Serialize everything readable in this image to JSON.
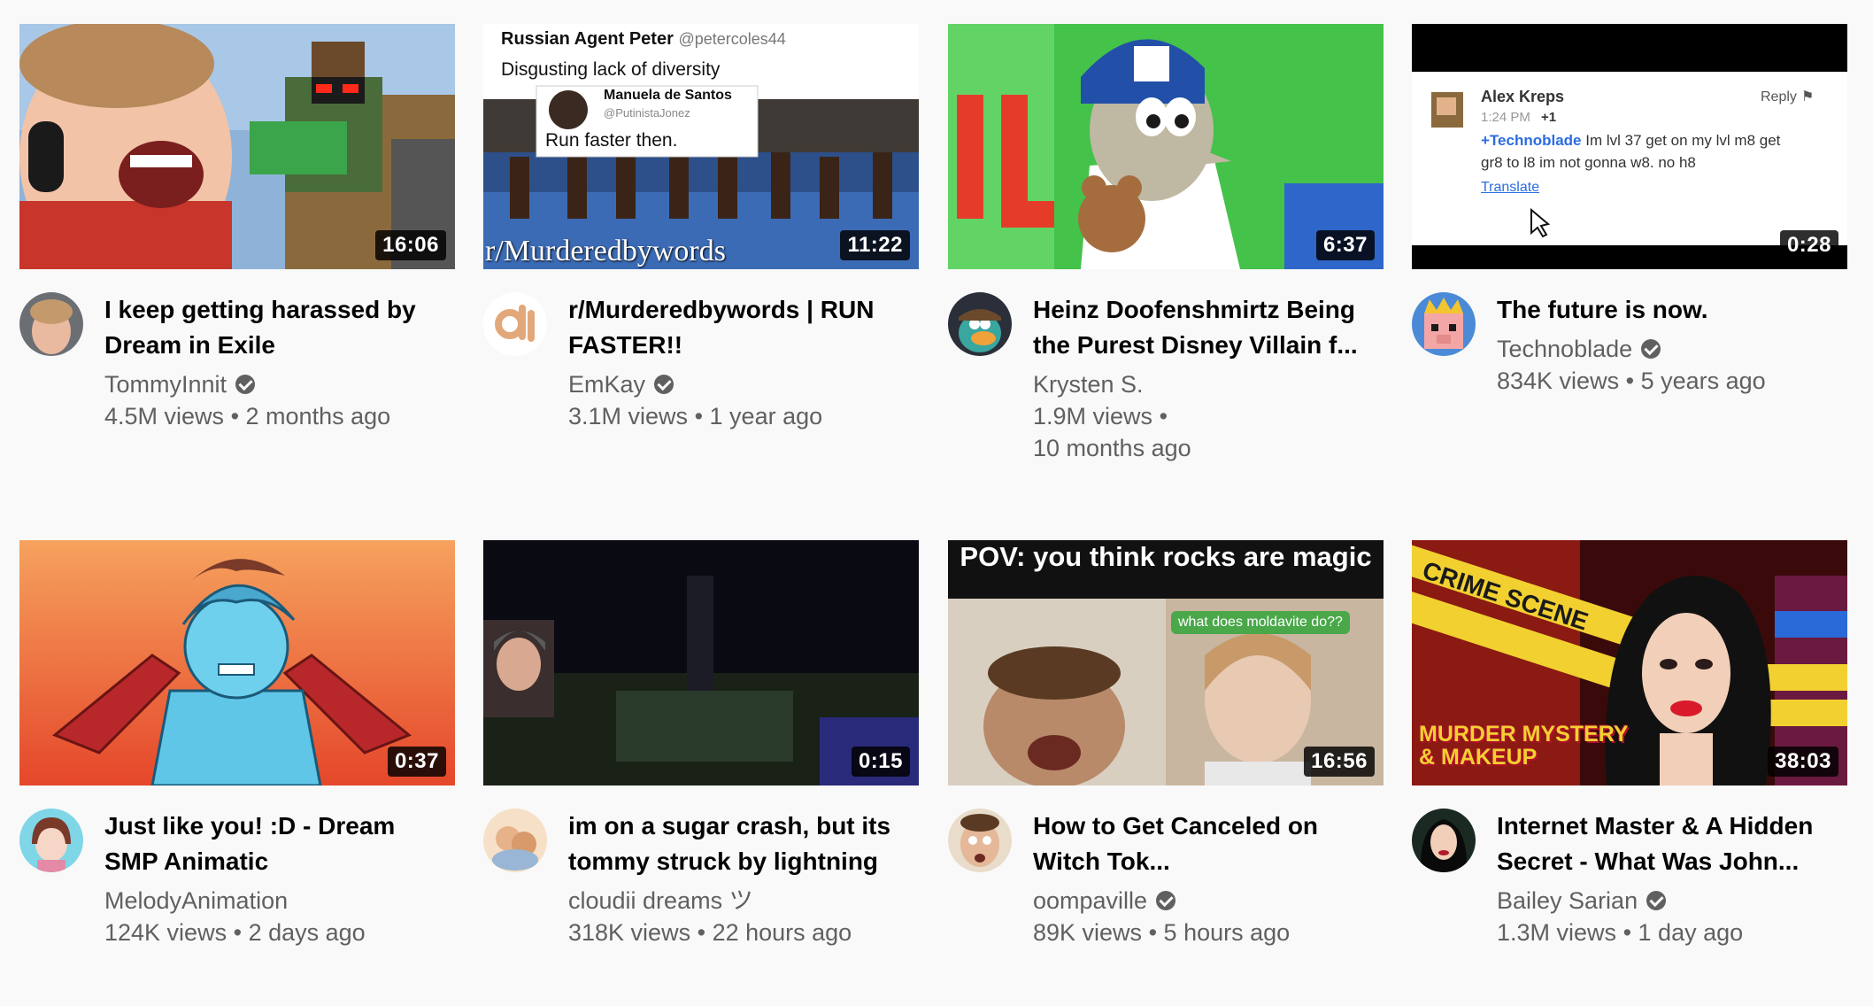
{
  "videos": [
    {
      "title": "I keep getting harassed by Dream in Exile",
      "channel": "TommyInnit",
      "verified": true,
      "views": "4.5M views",
      "sep": "•",
      "age": "2 months ago",
      "duration": "16:06"
    },
    {
      "title": "r/Murderedbywords | RUN FASTER!!",
      "channel": "EmKay",
      "verified": true,
      "views": "3.1M views",
      "sep": "•",
      "age": "1 year ago",
      "duration": "11:22",
      "thumb_text": {
        "author": "Russian Agent Peter",
        "handle": "@petercoles44",
        "tweet": "Disgusting lack of diversity",
        "reply_author": "Manuela de Santos",
        "reply_handle": "@PutinistaJonez",
        "reply": "Run faster then.",
        "caption": "r/Murderedbywords"
      }
    },
    {
      "title": "Heinz Doofenshmirtz Being the Purest Disney Villain f...",
      "channel": "Krysten S.",
      "verified": false,
      "views": "1.9M views",
      "sep": "•",
      "age": "10 months ago",
      "duration": "6:37"
    },
    {
      "title": "The future is now.",
      "channel": "Technoblade",
      "verified": true,
      "views": "834K views",
      "sep": "•",
      "age": "5 years ago",
      "duration": "0:28",
      "thumb_text": {
        "author": "Alex Kreps",
        "reply": "Reply",
        "time": "1:24 PM",
        "plus": "+1",
        "mention": "+Technoblade",
        "comment_a": " Im lvl 37 get on my lvl m8 get",
        "comment_b": "gr8 to l8 im not gonna w8. no h8",
        "translate": "Translate"
      }
    },
    {
      "title": "Just like you! :D - Dream SMP Animatic",
      "channel": "MelodyAnimation",
      "verified": false,
      "views": "124K views",
      "sep": "•",
      "age": "2 days ago",
      "duration": "0:37"
    },
    {
      "title": "im on a sugar crash, but its tommy struck by lightning",
      "channel": "cloudii dreams ツ",
      "verified": false,
      "views": "318K views",
      "sep": "•",
      "age": "22 hours ago",
      "duration": "0:15"
    },
    {
      "title": "How to Get Canceled on Witch Tok...",
      "channel": "oompaville",
      "verified": true,
      "views": "89K views",
      "sep": "•",
      "age": "5 hours ago",
      "duration": "16:56",
      "thumb_text": {
        "headline": "POV: you think rocks are magic",
        "bubble": "what does moldavite do??"
      }
    },
    {
      "title": "Internet Master & A Hidden Secret - What Was John...",
      "channel": "Bailey Sarian",
      "verified": true,
      "views": "1.3M views",
      "sep": "•",
      "age": "1 day ago",
      "duration": "38:03",
      "thumb_text": {
        "tape": "CRIME SCENE",
        "badge_a": "MURDER MYSTERY",
        "badge_b": "& MAKEUP"
      }
    }
  ]
}
